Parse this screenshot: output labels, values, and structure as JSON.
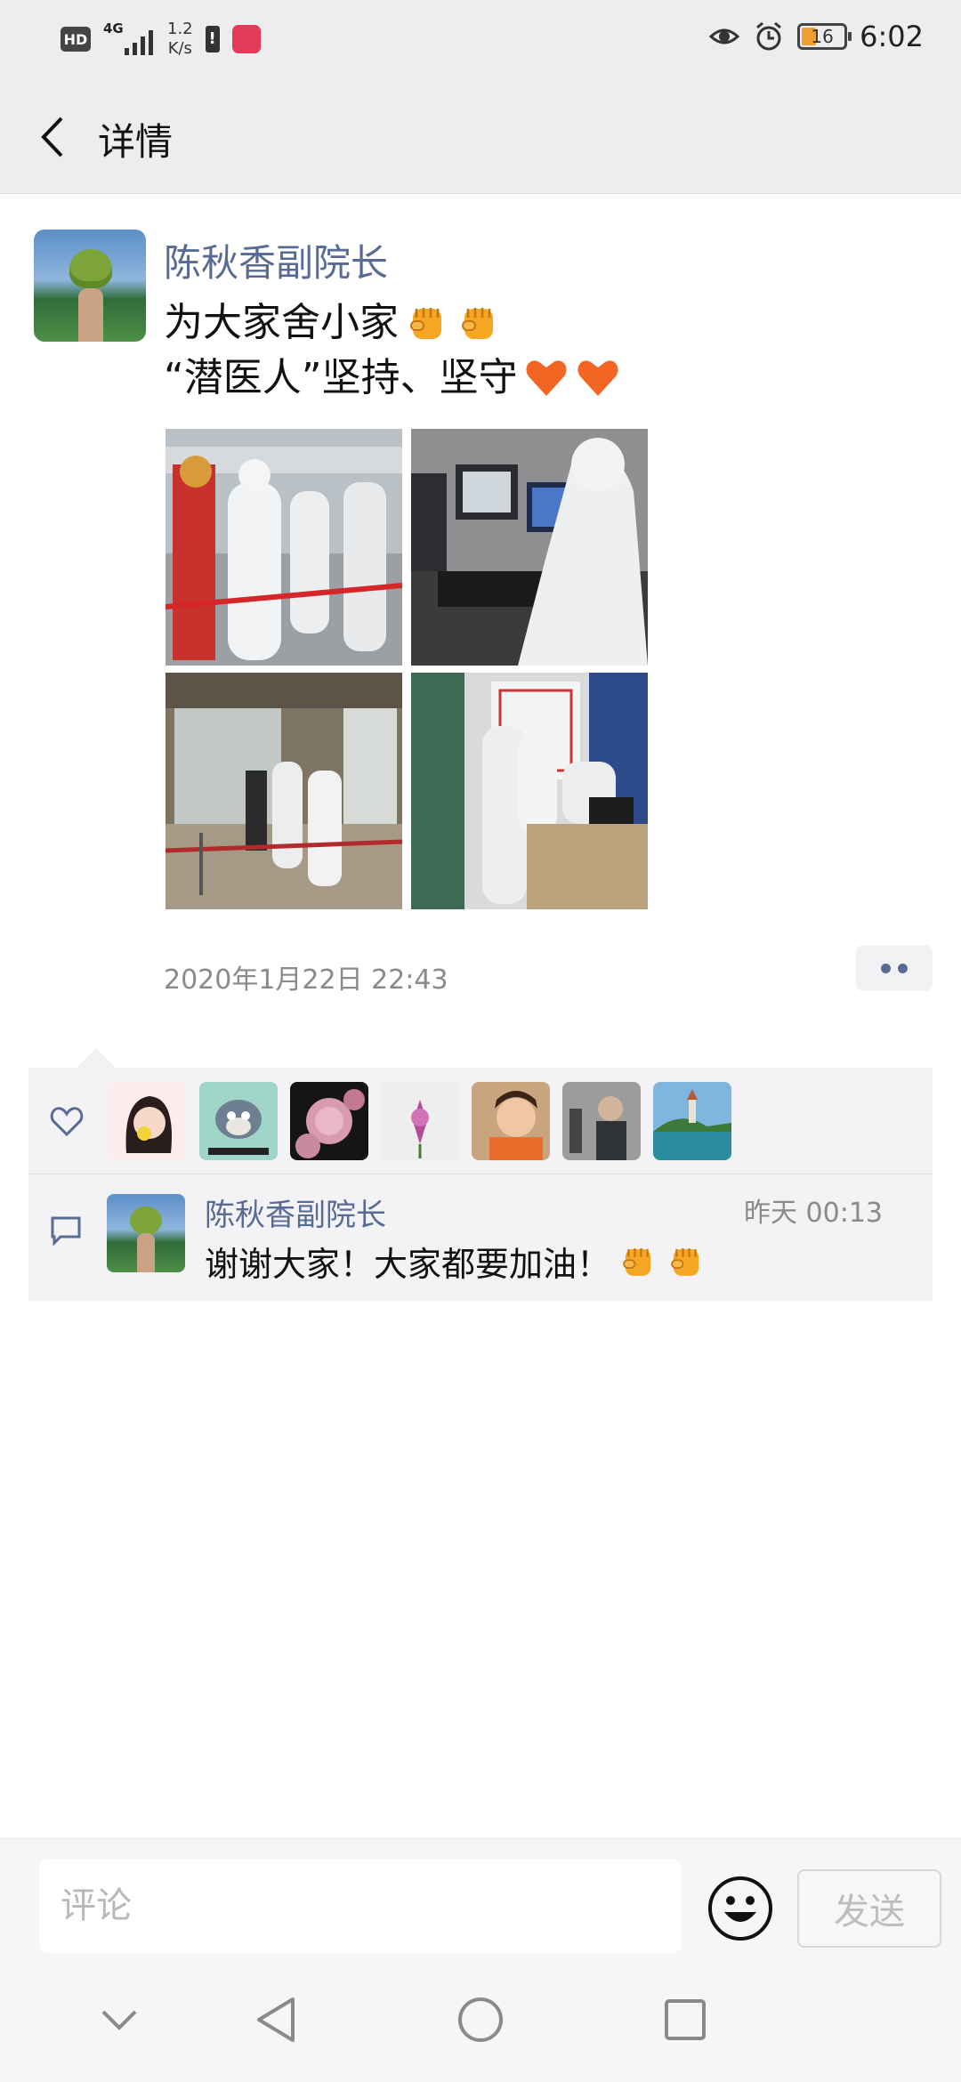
{
  "status_bar": {
    "hd": "HD",
    "network": "4G",
    "speed_value": "1.2",
    "speed_unit": "K/s",
    "alert": "!",
    "battery": "16",
    "time": "6:02"
  },
  "header": {
    "title": "详情",
    "back_icon": "chevron-left-icon"
  },
  "post": {
    "author": "陈秋香副院长",
    "text_line1": "为大家舍小家",
    "text_line2": "“潜医人”坚持、坚守",
    "line1_emojis": [
      "raised-fist",
      "raised-fist"
    ],
    "line2_emojis": [
      "orange-heart",
      "orange-heart"
    ],
    "photos": [
      {
        "name": "photo-temperature-check"
      },
      {
        "name": "photo-computer-workstation"
      },
      {
        "name": "photo-hospital-entrance"
      },
      {
        "name": "photo-reception-desk"
      }
    ],
    "date": "2020年1月22日 22:43"
  },
  "likes": {
    "icon": "heart-icon",
    "count_shown": 7
  },
  "comment": {
    "icon": "comment-icon",
    "author": "陈秋香副院长",
    "time": "昨天 00:13",
    "text": "谢谢大家！大家都要加油！",
    "emojis": [
      "raised-fist",
      "raised-fist"
    ]
  },
  "input_bar": {
    "placeholder": "评论",
    "send_label": "发送",
    "emoji_icon": "smiley-face-icon"
  },
  "system_nav": {
    "items": [
      "chevron-down-icon",
      "back-triangle-icon",
      "home-circle-icon",
      "recents-square-icon"
    ]
  },
  "colors": {
    "link_blue": "#576b95",
    "header_bg": "#ededed",
    "panel_bg": "#f3f3f5",
    "muted_text": "#8a8a8a"
  }
}
